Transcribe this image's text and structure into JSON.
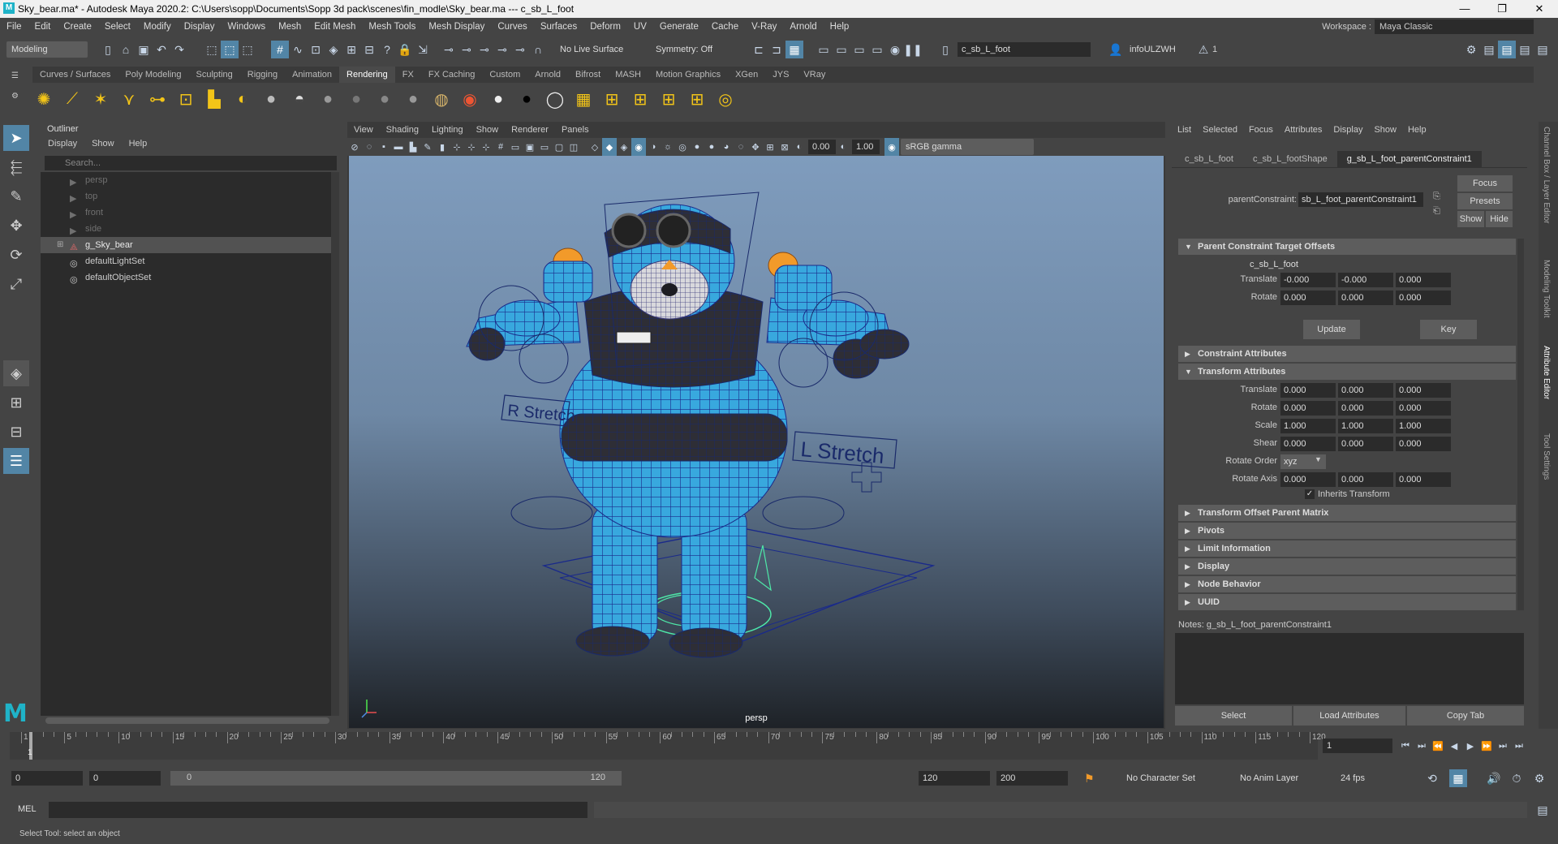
{
  "window": {
    "title": "Sky_bear.ma* - Autodesk Maya 2020.2: C:\\Users\\sopp\\Documents\\Sopp 3d pack\\scenes\\fin_modle\\Sky_bear.ma  ---  c_sb_L_foot",
    "logo_letter": "M",
    "min": "—",
    "max": "❐",
    "close": "✕"
  },
  "menubar": [
    "File",
    "Edit",
    "Create",
    "Select",
    "Modify",
    "Display",
    "Windows",
    "Mesh",
    "Edit Mesh",
    "Mesh Tools",
    "Mesh Display",
    "Curves",
    "Surfaces",
    "Deform",
    "UV",
    "Generate",
    "Cache",
    "V-Ray",
    "Arnold",
    "Help"
  ],
  "workspace": {
    "label": "Workspace :",
    "value": "Maya Classic"
  },
  "statusline": {
    "menu_set": "Modeling",
    "live_surface": "No Live Surface",
    "symmetry": "Symmetry: Off",
    "object_field": "c_sb_L_foot",
    "user": "infoULZWH",
    "alert_count": "1"
  },
  "shelf": {
    "tabs": [
      "Curves / Surfaces",
      "Poly Modeling",
      "Sculpting",
      "Rigging",
      "Animation",
      "Rendering",
      "FX",
      "FX Caching",
      "Custom",
      "Arnold",
      "Bifrost",
      "MASH",
      "Motion Graphics",
      "XGen",
      "JYS",
      "VRay"
    ],
    "active": "Rendering"
  },
  "outliner": {
    "title": "Outliner",
    "menu": [
      "Display",
      "Show",
      "Help"
    ],
    "search_placeholder": "Search...",
    "items": [
      {
        "name": "persp",
        "type": "camera"
      },
      {
        "name": "top",
        "type": "camera"
      },
      {
        "name": "front",
        "type": "camera"
      },
      {
        "name": "side",
        "type": "camera"
      },
      {
        "name": "g_Sky_bear",
        "type": "group"
      },
      {
        "name": "defaultLightSet",
        "type": "set"
      },
      {
        "name": "defaultObjectSet",
        "type": "set"
      }
    ]
  },
  "viewport": {
    "menu": [
      "View",
      "Shading",
      "Lighting",
      "Show",
      "Renderer",
      "Panels"
    ],
    "exposure": "0.00",
    "gamma": "1.00",
    "color_space": "sRGB gamma",
    "camera": "persp",
    "label_r": "R Stretch",
    "label_l": "L Stretch"
  },
  "attribute_editor": {
    "menu": [
      "List",
      "Selected",
      "Focus",
      "Attributes",
      "Display",
      "Show",
      "Help"
    ],
    "tabs": [
      "c_sb_L_foot",
      "c_sb_L_footShape",
      "g_sb_L_foot_parentConstraint1"
    ],
    "active_tab": "g_sb_L_foot_parentConstraint1",
    "node_label": "parentConstraint:",
    "node_value": "sb_L_foot_parentConstraint1",
    "buttons": {
      "focus": "Focus",
      "presets": "Presets",
      "show": "Show",
      "hide": "Hide",
      "update": "Update",
      "key": "Key"
    },
    "sections": {
      "pcto": "Parent Constraint Target Offsets",
      "constraint": "Constraint Attributes",
      "transform": "Transform Attributes",
      "topm": "Transform Offset Parent Matrix",
      "pivots": "Pivots",
      "limit": "Limit Information",
      "display": "Display",
      "nodebehavior": "Node Behavior",
      "uuid": "UUID"
    },
    "target": "c_sb_L_foot",
    "target_translate": [
      "-0.000",
      "-0.000",
      "0.000"
    ],
    "target_rotate": [
      "0.000",
      "0.000",
      "0.000"
    ],
    "labels": {
      "translate": "Translate",
      "rotate": "Rotate",
      "scale": "Scale",
      "shear": "Shear",
      "rotate_order": "Rotate Order",
      "rotate_axis": "Rotate Axis",
      "inherits": "Inherits Transform"
    },
    "translate": [
      "0.000",
      "0.000",
      "0.000"
    ],
    "rotate": [
      "0.000",
      "0.000",
      "0.000"
    ],
    "scale": [
      "1.000",
      "1.000",
      "1.000"
    ],
    "shear": [
      "0.000",
      "0.000",
      "0.000"
    ],
    "rotate_order": "xyz",
    "rotate_axis": [
      "0.000",
      "0.000",
      "0.000"
    ],
    "notes_label": "Notes:  g_sb_L_foot_parentConstraint1",
    "bottom_buttons": [
      "Select",
      "Load Attributes",
      "Copy Tab"
    ]
  },
  "side_tabs": [
    "Channel Box / Layer Editor",
    "Modeling Toolkit",
    "Attribute Editor",
    "Tool Settings"
  ],
  "timeline": {
    "ticks": [
      "1",
      "5",
      "10",
      "15",
      "20",
      "25",
      "30",
      "35",
      "40",
      "45",
      "50",
      "55",
      "60",
      "65",
      "70",
      "75",
      "80",
      "85",
      "90",
      "95",
      "100",
      "105",
      "110",
      "115",
      "120"
    ],
    "current_frame_field": "1",
    "current_frame_marker": "1"
  },
  "range": {
    "start": "0",
    "anim_start": "0",
    "slider_start": "0",
    "slider_end": "120",
    "end": "120",
    "anim_end": "200",
    "character_set": "No Character Set",
    "anim_layer": "No Anim Layer",
    "fps": "24 fps"
  },
  "mel": {
    "label": "MEL"
  },
  "helpline": "Select Tool: select an object",
  "colors": {
    "accent": "#5285a6",
    "mesh": "#38a8de",
    "wire": "#1a2a8a",
    "ctrl": "#4ee8a8"
  }
}
